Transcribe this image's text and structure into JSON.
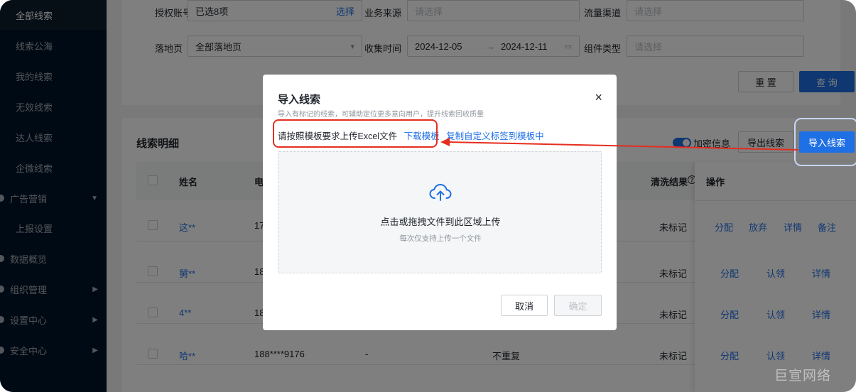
{
  "sidebar": {
    "items": [
      {
        "label": "全部线索"
      },
      {
        "label": "线索公海"
      },
      {
        "label": "我的线索"
      },
      {
        "label": "无效线索"
      },
      {
        "label": "达人线索"
      },
      {
        "label": "企微线索"
      },
      {
        "label": "广告营销"
      },
      {
        "label": "上报设置"
      },
      {
        "label": "数据概览"
      },
      {
        "label": "组织管理"
      },
      {
        "label": "设置中心"
      },
      {
        "label": "安全中心"
      }
    ]
  },
  "filters": {
    "auth_account_label": "授权账号",
    "auth_account_value": "已选8项",
    "auth_account_action": "选择",
    "biz_source_label": "业务来源",
    "biz_source_placeholder": "请选择",
    "traffic_channel_label": "流量渠道",
    "traffic_channel_placeholder": "请选择",
    "landing_label": "落地页",
    "landing_value": "全部落地页",
    "collect_time_label": "收集时间",
    "date_start": "2024-12-05",
    "date_arrow": "→",
    "date_end": "2024-12-11",
    "component_type_label": "组件类型",
    "component_type_placeholder": "请选择",
    "reset_label": "重 置",
    "query_label": "查 询"
  },
  "list": {
    "title": "线索明细",
    "encrypt_label": "加密信息",
    "export_label": "导出线索",
    "import_label": "导入线索",
    "col_name": "姓名",
    "col_phone": "电",
    "col_clean": "清洗结果",
    "col_clean_icon": "?",
    "col_ops": "操作",
    "rows": [
      {
        "name": "这**",
        "phone": "17",
        "clean": "未标记",
        "ops": [
          "分配",
          "放弃",
          "详情",
          "备注"
        ]
      },
      {
        "name": "舅**",
        "phone": "18",
        "clean": "未标记",
        "ops": [
          "分配",
          "认领",
          "详情"
        ]
      },
      {
        "name": "4**",
        "phone": "18",
        "clean": "未标记",
        "ops": [
          "分配",
          "认领",
          "详情"
        ]
      },
      {
        "name": "哈**",
        "phone": "188****9176",
        "dash": "-",
        "dup": "不重复",
        "clean": "未标记",
        "ops": [
          "分配",
          "认领",
          "详情"
        ]
      }
    ]
  },
  "modal": {
    "title": "导入线索",
    "subtitle": "导入有标记的线索，可辅助定位更多意向用户，提升线索回收质量",
    "instruction": "请按照模板要求上传Excel文件",
    "download_link": "下载模板",
    "copy_link": "复制自定义标签到模板中",
    "drop_main": "点击或拖拽文件到此区域上传",
    "drop_sub": "每次仅支持上传一个文件",
    "cancel_label": "取消",
    "ok_label": "确定",
    "close_glyph": "×"
  },
  "watermark": "巨宣网络",
  "colors": {
    "accent": "#1f6fe5",
    "highlight_red": "#e52d1f",
    "sidebar_bg": "#001529"
  }
}
